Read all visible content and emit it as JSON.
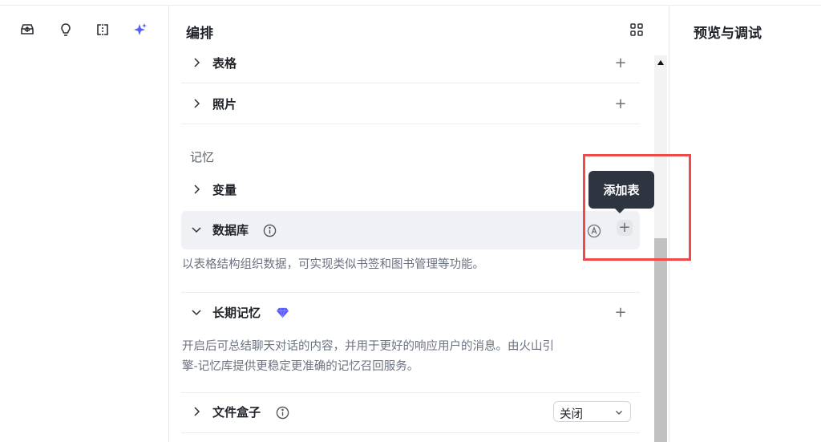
{
  "middle": {
    "title": "编排",
    "rows": {
      "table": {
        "label": "表格"
      },
      "photo": {
        "label": "照片"
      },
      "variable": {
        "label": "变量"
      },
      "database": {
        "label": "数据库",
        "description": "以表格结构组织数据，可实现类似书签和图书管理等功能。"
      },
      "long_memory": {
        "label": "长期记忆",
        "description_line1": "开启后可总结聊天对话的内容，并用于更好的响应用户的消息。由火山引",
        "description_line2": "擎-记忆库提供更稳定更准确的记忆召回服务。"
      },
      "file_box": {
        "label": "文件盒子",
        "select_value": "关闭"
      }
    },
    "memory_section_title": "记忆",
    "plus_symbol": "+"
  },
  "tooltip": {
    "text": "添加表"
  },
  "right": {
    "title": "预览与调试"
  },
  "colors": {
    "accent": "#5b5cf6",
    "highlight_box": "#ef4a4a",
    "tooltip_bg": "#2e3440"
  },
  "icons": {
    "rail": [
      "inbox-icon",
      "bulb-icon",
      "split-view-icon",
      "sparkle-icon"
    ],
    "misc": [
      "layout-grid-icon",
      "chevron-right-icon",
      "chevron-down-icon",
      "info-icon",
      "auto-mode-icon",
      "diamond-premium-icon"
    ]
  }
}
